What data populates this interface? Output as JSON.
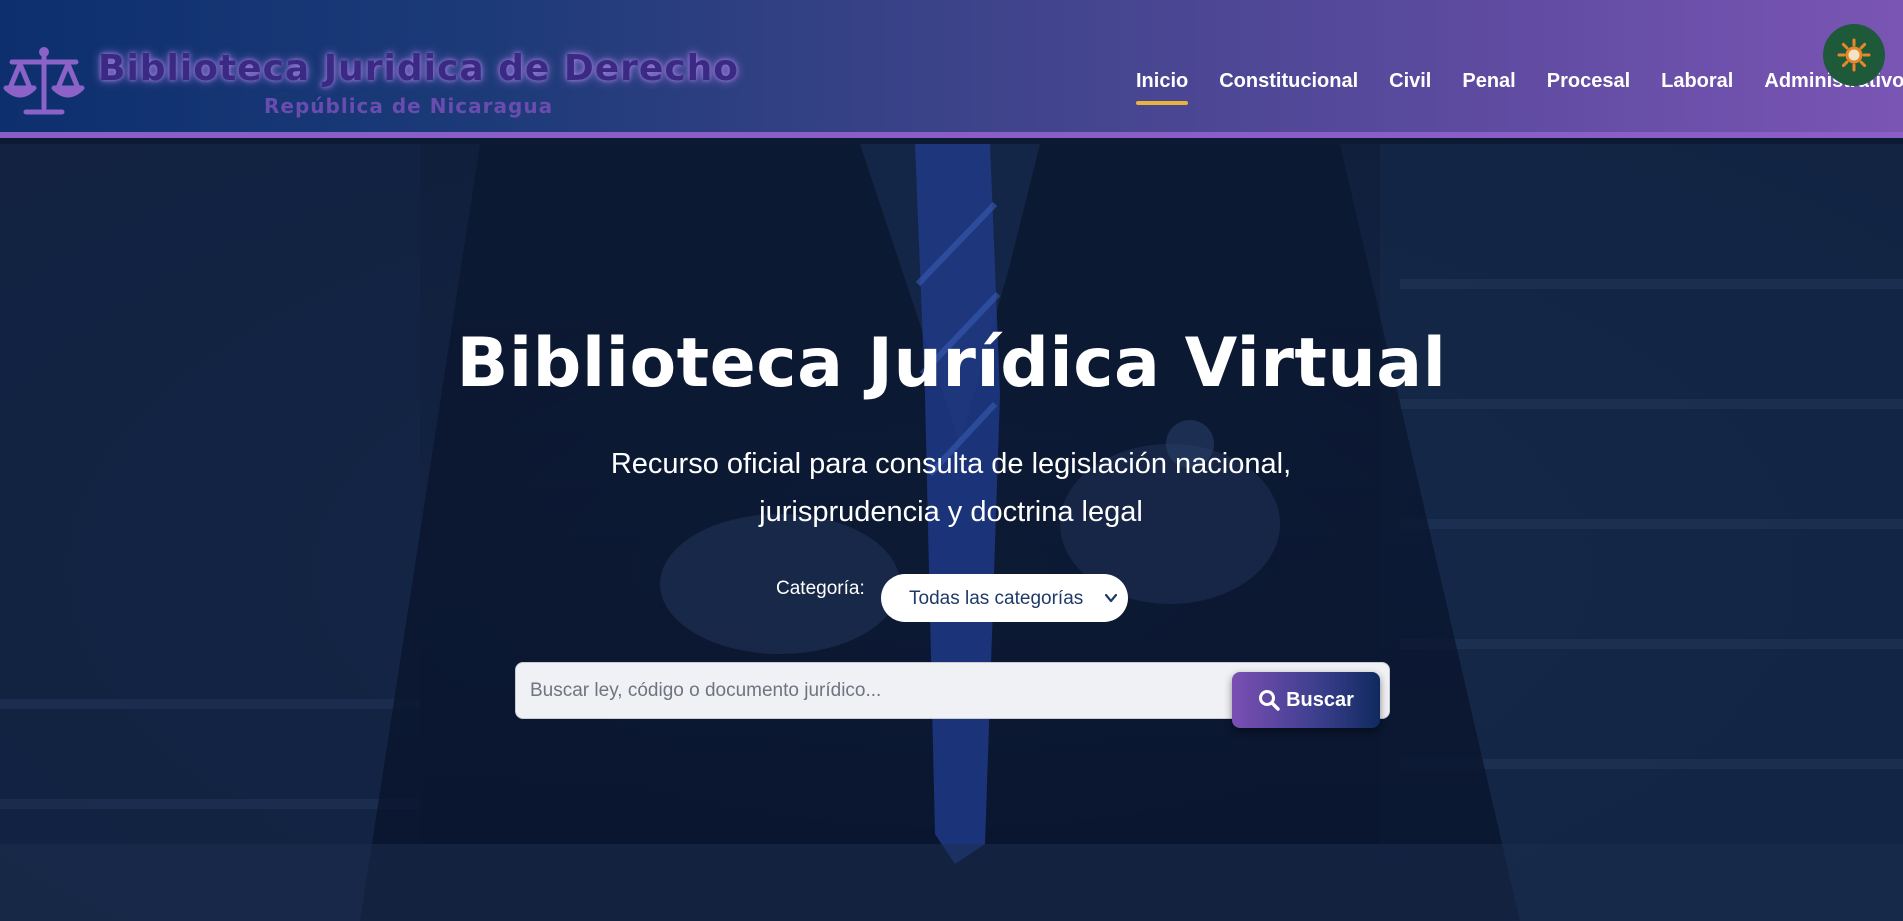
{
  "header": {
    "brand": {
      "title": "Biblioteca Juridica de Derecho",
      "subtitle": "República de Nicaragua",
      "logo_icon": "scales-of-justice-icon"
    },
    "nav": {
      "active": "Inicio",
      "items": [
        {
          "label": "Inicio"
        },
        {
          "label": "Constitucional"
        },
        {
          "label": "Civil"
        },
        {
          "label": "Penal"
        },
        {
          "label": "Procesal"
        },
        {
          "label": "Laboral"
        },
        {
          "label": "Administrativo"
        }
      ]
    },
    "theme_toggle": {
      "icon": "sun-icon"
    }
  },
  "hero": {
    "title": "Biblioteca Jurídica Virtual",
    "subtitle_line1": "Recurso oficial para consulta de legislación nacional,",
    "subtitle_line2": "jurisprudencia y doctrina legal",
    "category": {
      "label": "Categoría:",
      "selected": "Todas las categorías"
    },
    "search": {
      "placeholder": "Buscar ley, código o documento jurídico...",
      "value": "",
      "button_label": "Buscar",
      "button_icon": "search-icon"
    }
  },
  "colors": {
    "header_start": "#0d2f6e",
    "header_end": "#7a55b4",
    "header_border": "#8a5ec6",
    "nav_active_underline": "#e8b53a",
    "brand_text": "#3b2a84",
    "hero_bg": "#0f1e3c",
    "toggle_bg": "#1e5a3a",
    "sun": "#e8862a"
  }
}
